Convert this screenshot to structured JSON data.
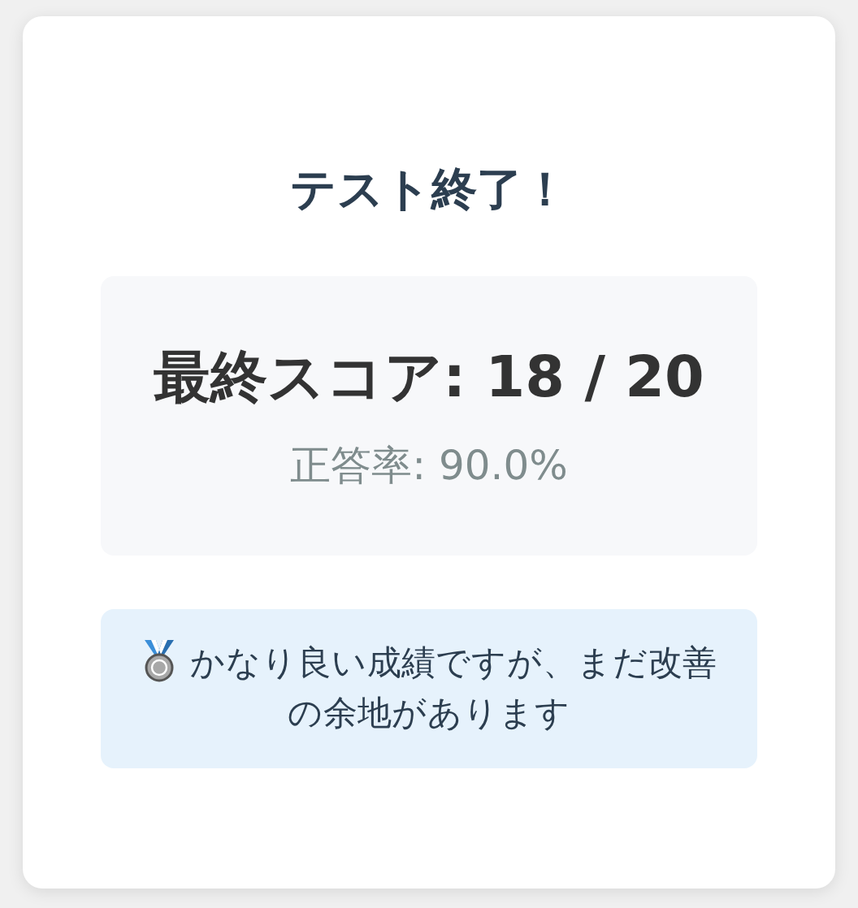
{
  "title": "テスト終了！",
  "score": {
    "label": "最終スコア: 18 / 20",
    "rate": "正答率: 90.0%"
  },
  "message": {
    "text": "かなり良い成績ですが、まだ改善の余地があります"
  }
}
